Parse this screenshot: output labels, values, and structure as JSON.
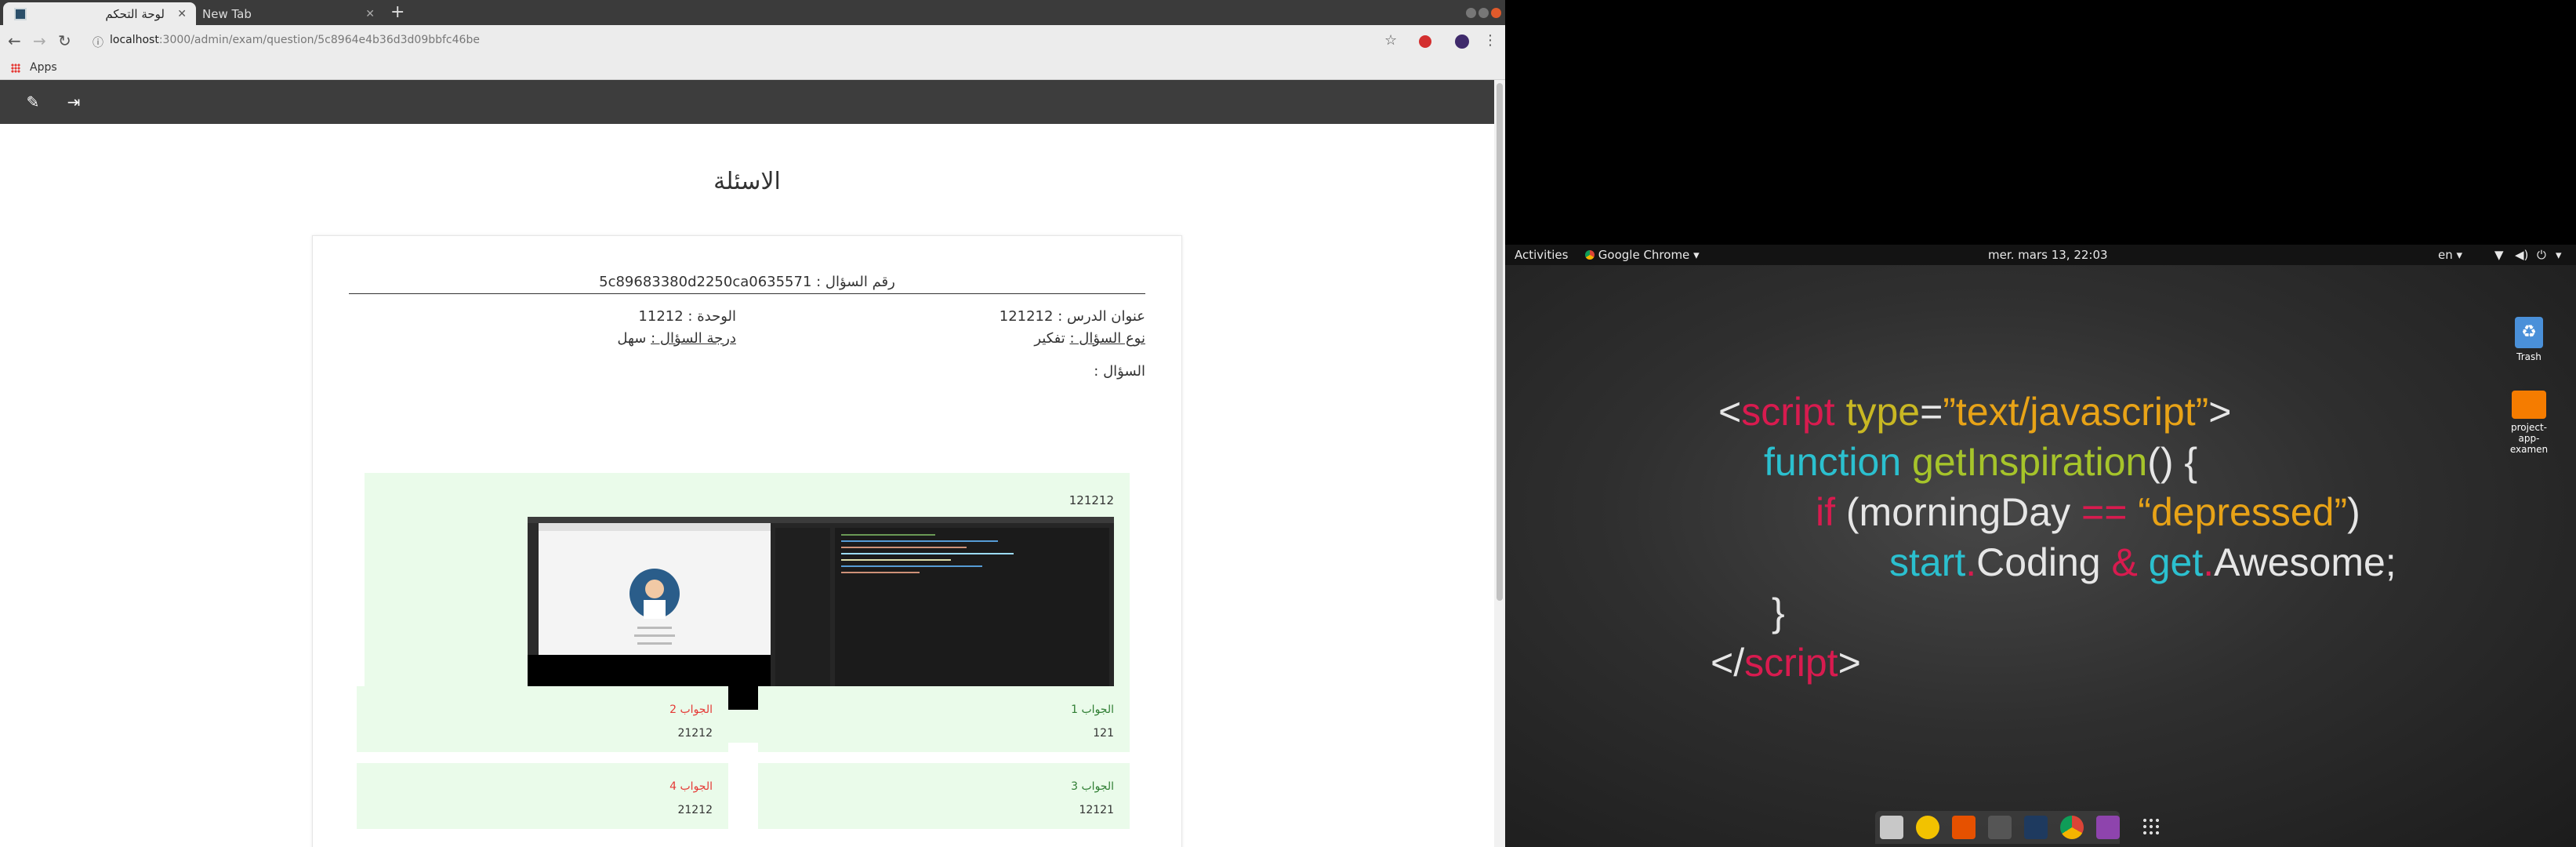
{
  "browser": {
    "tabs": [
      {
        "title": "لوحة التحكم",
        "active": true
      },
      {
        "title": "New Tab",
        "active": false
      }
    ],
    "url_host": "localhost",
    "url_path": ":3000/admin/exam/question/5c8964e4b36d3d09bbfc46be",
    "bookmarks_apps": "Apps"
  },
  "page": {
    "title": "الاسئلة",
    "question_id": "رقم السؤال : 5c89683380d2250ca0635571",
    "lesson_title_label": "عنوان الدرس :",
    "lesson_title_value": "121212",
    "unit_label": "الوحدة :",
    "unit_value": "11212",
    "question_type_label": "نوع السؤال :",
    "question_type_value": "تفكير",
    "difficulty_label": "درجة السؤال :",
    "difficulty_value": "سهل",
    "question_label": "السؤال :",
    "question_text": "121212",
    "answers": [
      {
        "label": "الجواب 1",
        "value": "121",
        "correct": true
      },
      {
        "label": "الجواب 2",
        "value": "21212",
        "correct": false
      },
      {
        "label": "الجواب 3",
        "value": "12121",
        "correct": true
      },
      {
        "label": "الجواب 4",
        "value": "21212",
        "correct": false
      }
    ]
  },
  "gnome": {
    "activities": "Activities",
    "app_menu": "Google Chrome",
    "clock": "mer. mars 13, 22:03",
    "lang": "en",
    "desktop_icons": [
      "Trash",
      "project-app-examen"
    ]
  },
  "wallpaper_code": {
    "l1_lt": "<",
    "l1_script": "script",
    "l1_type": " type",
    "l1_eq": "=",
    "l1_str": "”text/javascript”",
    "l1_gt": ">",
    "l2_fn": "function",
    "l2_name": " getInspiration",
    "l2_rest": "() {",
    "l3_if": "if",
    "l3_open": " (morningDay ",
    "l3_op": "==",
    "l3_str": " “depressed”",
    "l3_close": ")",
    "l4_start": "start",
    "l4_dot1": ".",
    "l4_coding": "Coding ",
    "l4_amp": "&",
    "l4_get": " get",
    "l4_dot2": ".",
    "l4_awesome": "Awesome;",
    "l5": "}",
    "l6_lt": "</",
    "l6_script": "script",
    "l6_gt": ">"
  },
  "colors": {
    "correct": "#2e7d32",
    "wrong": "#e53935",
    "answer_bg": "#eafbea",
    "appbar": "#3d3d3d"
  }
}
